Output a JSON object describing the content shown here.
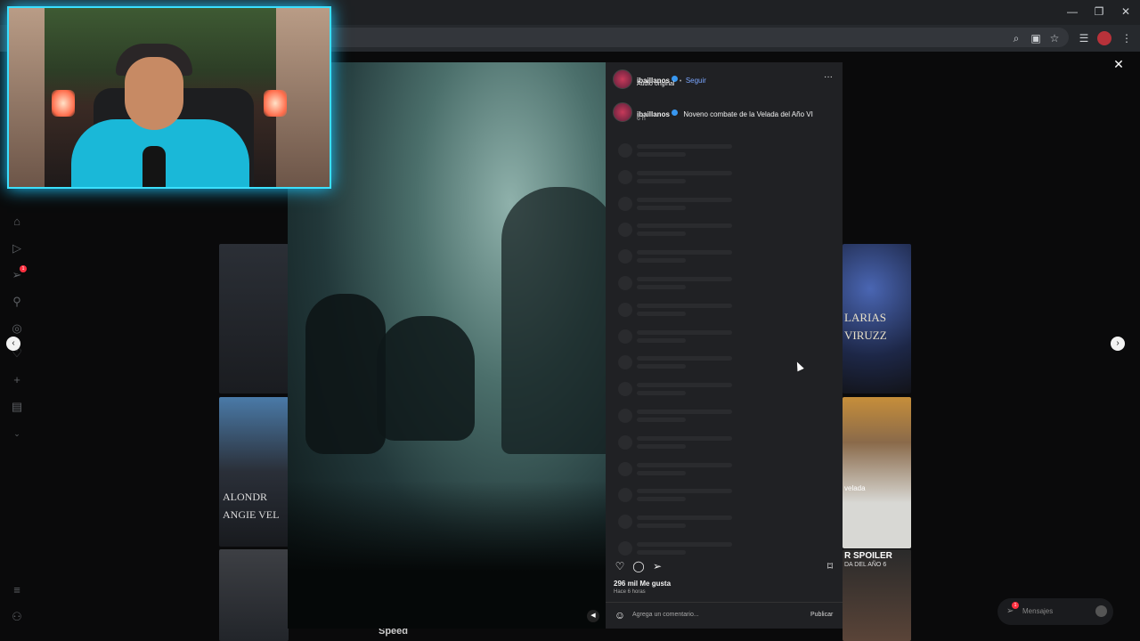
{
  "browser": {
    "window_controls": [
      "—",
      "❐",
      "✕"
    ],
    "toolbar_icons": [
      "zoom-icon",
      "install-icon",
      "bookmark-star-icon",
      "reading-list-icon",
      "profile-icon",
      "menu-icon"
    ]
  },
  "instagram_nav": {
    "items": [
      "home",
      "reels",
      "messages",
      "search",
      "explore",
      "notifications",
      "create",
      "dashboard",
      "more",
      "meta"
    ],
    "notification_badge": "1"
  },
  "modal": {
    "close": "✕",
    "prev": "‹",
    "next": "›"
  },
  "post": {
    "username": "ibaillanos",
    "follow_label": "Seguir",
    "audio": "Audio original",
    "more": "···",
    "caption_user": "ibaillanos",
    "caption_text": "Noveno combate de la Velada del Año VI",
    "caption_time": "6 h",
    "likes": "296 mil Me gusta",
    "posted_ago": "Hace 6 horas",
    "comment_placeholder": "Agrega un comentario...",
    "publish_label": "Publicar",
    "mute_icon": "speaker-icon"
  },
  "background": {
    "tile_texts": [
      "ALONDR",
      "ANGIE VEL",
      "LARIAS",
      "VIRUZZ",
      "velada",
      "R SPOILER",
      "DA DEL AÑO 6",
      "Speed"
    ]
  },
  "messages_bar": {
    "label": "Mensajes",
    "badge": "1"
  },
  "colors": {
    "accent_blue": "#3897f0",
    "panel_bg": "#202124",
    "webcam_glow": "#3be0ff"
  }
}
